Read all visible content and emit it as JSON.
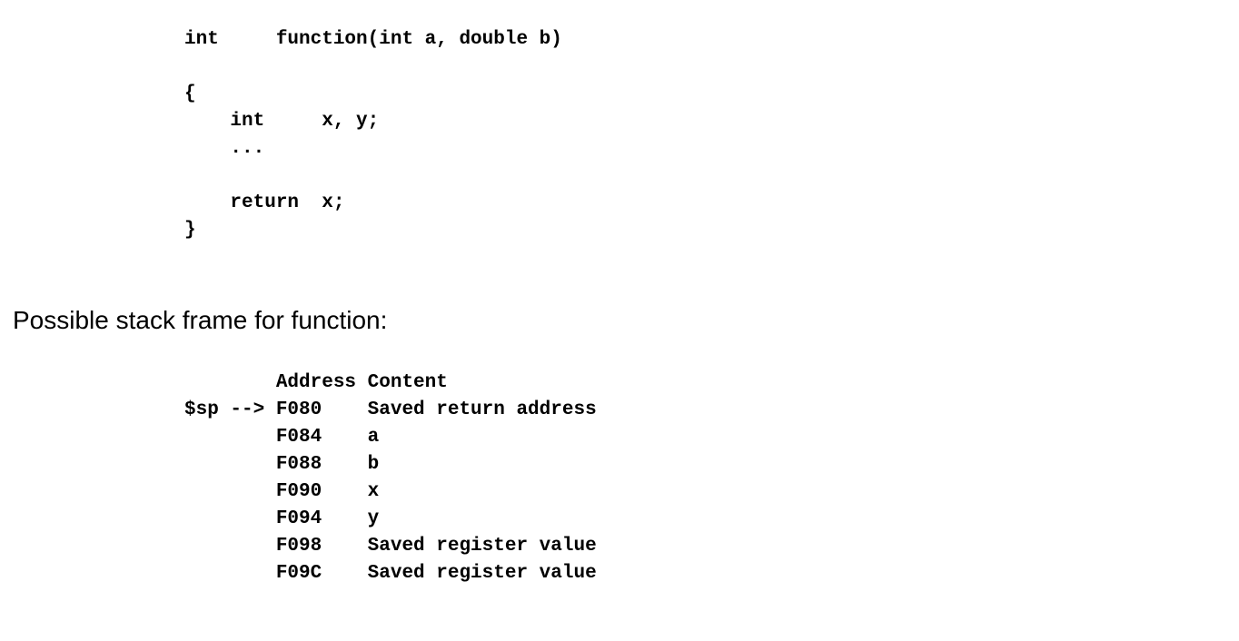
{
  "code_lines": [
    "int     function(int a, double b)",
    "",
    "{",
    "    int     x, y;",
    "    ...",
    "",
    "    return  x;",
    "}"
  ],
  "heading": "Possible stack frame for function:",
  "stack_lines": [
    "        Address Content",
    "$sp --> F080    Saved return address",
    "        F084    a",
    "        F088    b",
    "        F090    x",
    "        F094    y",
    "        F098    Saved register value",
    "        F09C    Saved register value"
  ]
}
